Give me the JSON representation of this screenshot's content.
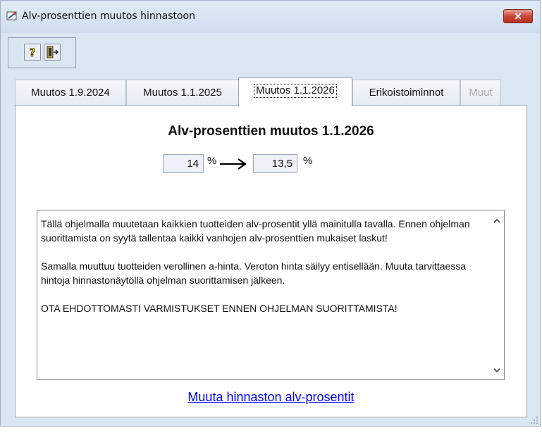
{
  "window": {
    "title": "Alv-prosenttien muutos hinnastoon",
    "close_glyph": "✕"
  },
  "toolbar": {
    "buttons": [
      {
        "icon": "help-icon"
      },
      {
        "icon": "exit-door-icon"
      }
    ]
  },
  "tabs": [
    {
      "label": "Muutos 1.9.2024",
      "active": false,
      "enabled": true
    },
    {
      "label": "Muutos 1.1.2025",
      "active": false,
      "enabled": true
    },
    {
      "label": "Muutos 1.1.2026",
      "active": true,
      "enabled": true
    },
    {
      "label": "Erikoistoiminnot",
      "active": false,
      "enabled": true
    },
    {
      "label": "Muut",
      "active": false,
      "enabled": false
    }
  ],
  "panel": {
    "heading": "Alv-prosenttien muutos 1.1.2026",
    "old_rate": "14",
    "new_rate": "13,5",
    "percent_sign": "%",
    "info_paragraphs": [
      "Tällä ohjelmalla muutetaan kaikkien tuotteiden alv-prosentit yllä mainitulla tavalla. Ennen ohjelman suorittamista on syytä tallentaa kaikki vanhojen alv-prosenttien mukaiset laskut!",
      "Samalla muuttuu tuotteiden verollinen a-hinta. Veroton hinta säilyy entisellään. Muuta tarvittaessa hintoja hinnastonäytöllä ohjelman suorittamisen jälkeen.",
      "OTA EHDOTTOMASTI VARMISTUKSET ENNEN OHJELMAN SUORITTAMISTA!"
    ],
    "action_link": "Muuta hinnaston alv-prosentit"
  },
  "colors": {
    "window_bg": "#dbe6f3",
    "link": "#0000ff",
    "close_button": "#c9473a"
  }
}
